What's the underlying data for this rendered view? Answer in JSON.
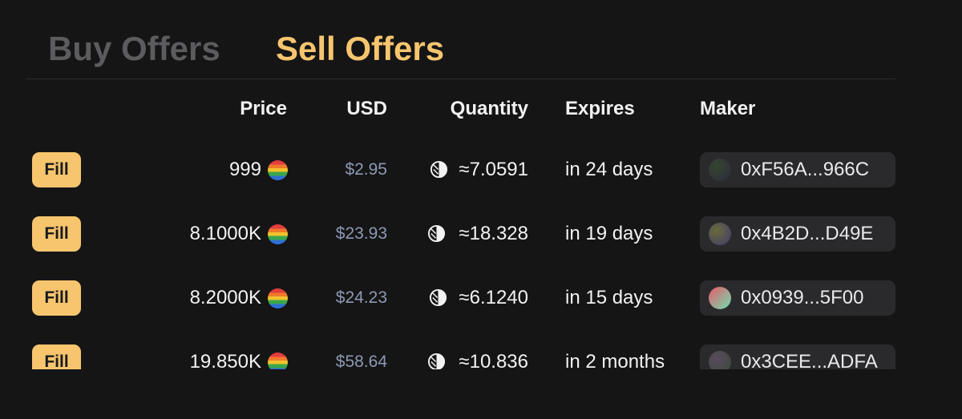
{
  "tabs": {
    "buy_label": "Buy Offers",
    "sell_label": "Sell Offers",
    "active": "Sell Offers"
  },
  "colors": {
    "accent": "#f6c56e",
    "inactive_tab": "#5c5c5f",
    "background": "#151516",
    "usd_text": "#8d99b3"
  },
  "columns": {
    "price": "Price",
    "usd": "USD",
    "quantity": "Quantity",
    "expires": "Expires",
    "maker": "Maker"
  },
  "rows": [
    {
      "fill_label": "Fill",
      "price": "999",
      "price_icon": "token-icon",
      "usd": "$2.95",
      "quantity_icon": "half-circle-icon",
      "quantity": "≈7.0591",
      "expires": "in 24 days",
      "maker": "0xF56A...966C",
      "maker_avatar_colors": [
        "#35452f",
        "#2c2a3c"
      ]
    },
    {
      "fill_label": "Fill",
      "price": "8.1000K",
      "price_icon": "token-icon",
      "usd": "$23.93",
      "quantity_icon": "half-circle-icon",
      "quantity": "≈18.328",
      "expires": "in 19 days",
      "maker": "0x4B2D...D49E",
      "maker_avatar_colors": [
        "#6a6a3a",
        "#3e3a6e"
      ]
    },
    {
      "fill_label": "Fill",
      "price": "8.2000K",
      "price_icon": "token-icon",
      "usd": "$24.23",
      "quantity_icon": "half-circle-icon",
      "quantity": "≈6.1240",
      "expires": "in 15 days",
      "maker": "0x0939...5F00",
      "maker_avatar_colors": [
        "#e85a6a",
        "#6fe0b0"
      ]
    },
    {
      "fill_label": "Fill",
      "price": "19.850K",
      "price_icon": "token-icon",
      "usd": "$58.64",
      "quantity_icon": "half-circle-icon",
      "quantity": "≈10.836",
      "expires": "in 2 months",
      "maker": "0x3CEE...ADFA",
      "maker_avatar_colors": [
        "#5a4a5e",
        "#3a4a3a"
      ]
    }
  ]
}
